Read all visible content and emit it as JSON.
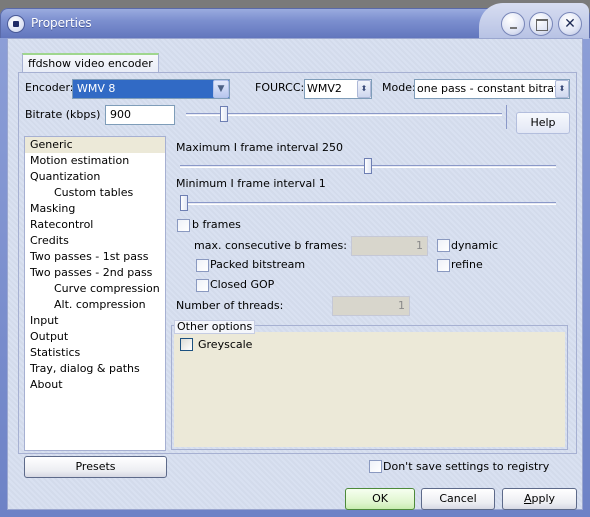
{
  "window": {
    "title": "Properties",
    "controls": {
      "minimize": "minimize",
      "maximize": "maximize",
      "close": "✕"
    }
  },
  "tab": {
    "label": "ffdshow video encoder"
  },
  "encoder": {
    "label": "Encoder:",
    "value": "WMV 8",
    "fourcc_label": "FOURCC:",
    "fourcc_value": "WMV2",
    "mode_label": "Mode:",
    "mode_value": "one pass - constant bitrate"
  },
  "bitrate": {
    "label": "Bitrate (kbps)",
    "value": "900",
    "slider_fraction": 0.11
  },
  "help_button": "Help",
  "sidebar": {
    "items": [
      {
        "label": "Generic",
        "level": 0,
        "selected": true
      },
      {
        "label": "Motion estimation",
        "level": 0
      },
      {
        "label": "Quantization",
        "level": 0
      },
      {
        "label": "Custom tables",
        "level": 1
      },
      {
        "label": "Masking",
        "level": 0
      },
      {
        "label": "Ratecontrol",
        "level": 0
      },
      {
        "label": "Credits",
        "level": 0
      },
      {
        "label": "Two passes - 1st pass",
        "level": 0
      },
      {
        "label": "Two passes - 2nd pass",
        "level": 0
      },
      {
        "label": "Curve compression",
        "level": 1
      },
      {
        "label": "Alt. compression",
        "level": 1
      },
      {
        "label": "Input",
        "level": 0
      },
      {
        "label": "Output",
        "level": 0
      },
      {
        "label": "Statistics",
        "level": 0
      },
      {
        "label": "Tray, dialog & paths",
        "level": 0
      },
      {
        "label": "About",
        "level": 0
      }
    ],
    "presets_button": "Presets"
  },
  "generic": {
    "max_i_frame_label": "Maximum I frame interval 250",
    "max_i_frame_fraction": 0.5,
    "min_i_frame_label": "Minimum I frame interval 1",
    "min_i_frame_fraction": 0.0,
    "b_frames_label": "b frames",
    "b_frames_checked": false,
    "max_consecutive_label": "max. consecutive b frames:",
    "max_consecutive_value": "1",
    "dynamic_label": "dynamic",
    "refine_label": "refine",
    "packed_bitstream_label": "Packed bitstream",
    "closed_gop_label": "Closed GOP",
    "threads_label": "Number of threads:",
    "threads_value": "1",
    "other_options_label": "Other options",
    "greyscale_label": "Greyscale"
  },
  "footer": {
    "dont_save_label": "Don't save settings to registry",
    "ok": "OK",
    "cancel": "Cancel",
    "apply_accel": "A",
    "apply_rest": "pply"
  }
}
